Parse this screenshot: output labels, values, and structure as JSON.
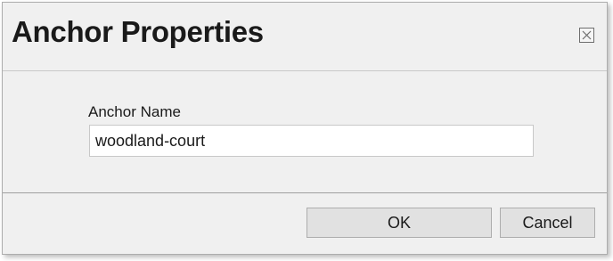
{
  "dialog": {
    "title": "Anchor Properties",
    "close_icon": "close-icon"
  },
  "form": {
    "anchor_name_label": "Anchor Name",
    "anchor_name_value": "woodland-court"
  },
  "buttons": {
    "ok_label": "OK",
    "cancel_label": "Cancel"
  }
}
